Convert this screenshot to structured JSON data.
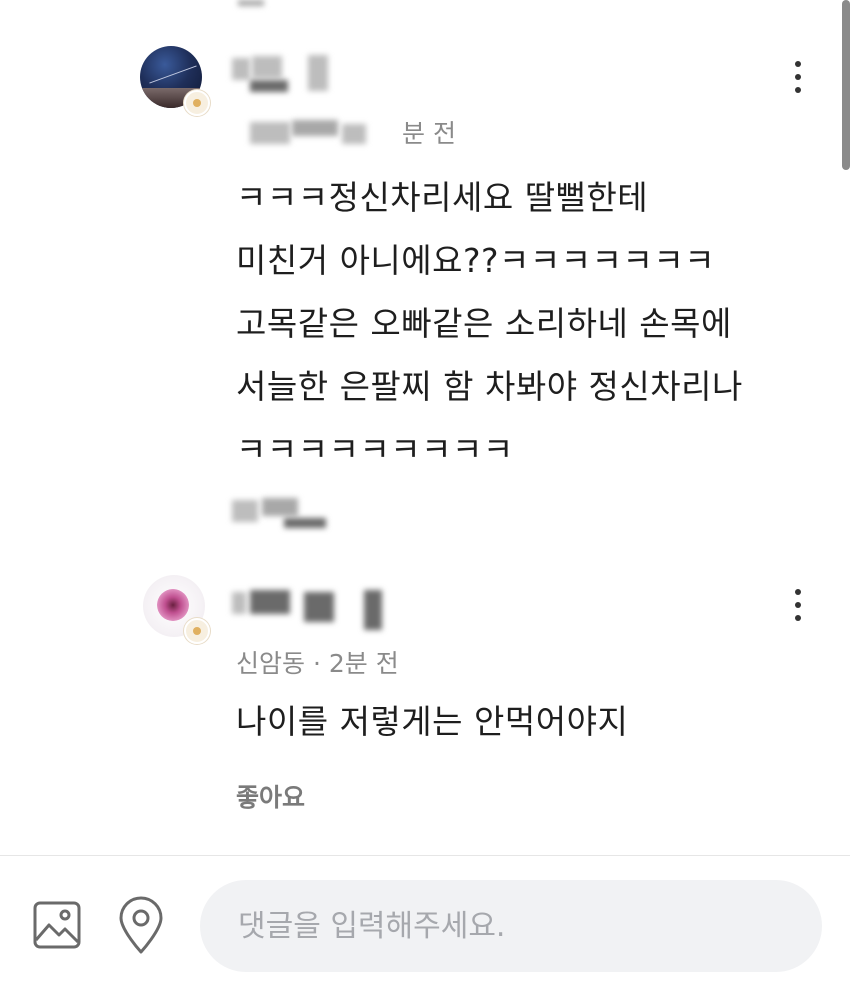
{
  "comments": [
    {
      "time": "분 전",
      "body": "ㅋㅋㅋ정신차리세요 딸뻘한테\n미친거 아니에요??ㅋㅋㅋㅋㅋㅋㅋ\n고목같은 오빠같은 소리하네 손목에\n서늘한 은팔찌 함 차봐야 정신차리나\nㅋㅋㅋㅋㅋㅋㅋㅋㅋ"
    },
    {
      "location_time": "신암동 · 2분 전",
      "body": "나이를 저렇게는 안먹어야지",
      "like_label": "좋아요"
    }
  ],
  "composer": {
    "placeholder": "댓글을 입력해주세요.",
    "image_icon": "image-icon",
    "location_icon": "location-pin-icon"
  },
  "colors": {
    "background": "#ffffff",
    "input_background": "#f1f2f4",
    "meta_text": "#8a8a8a",
    "body_text": "#1e1e1e"
  }
}
